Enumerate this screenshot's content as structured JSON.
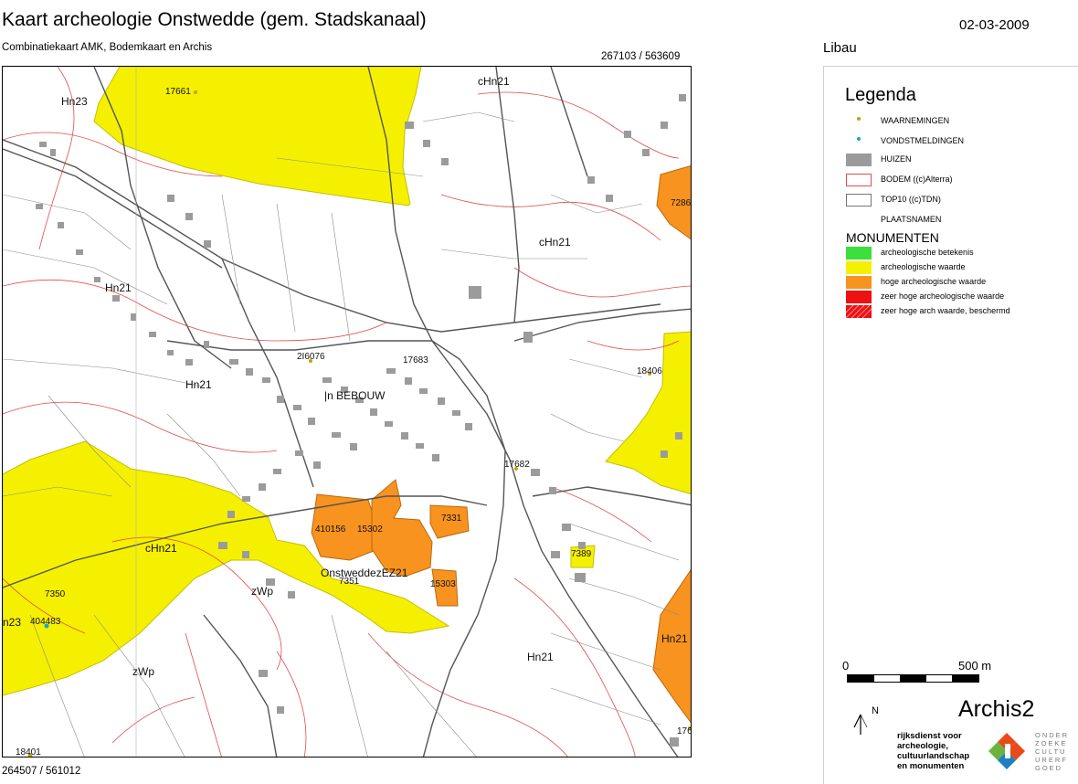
{
  "header": {
    "title": "Kaart archeologie Onstwedde (gem. Stadskanaal)",
    "date": "02-03-2009",
    "subtitle": "Combinatiekaart AMK, Bodemkaart en Archis",
    "coord_top_right": "267103 / 563609",
    "coord_bottom_left": "264507 / 561012",
    "place": "Libau"
  },
  "colors": {
    "yellow": "#f5f000",
    "orange": "#f7931e",
    "green": "#3ce03c",
    "red": "#ee1111",
    "house": "#9b9b9b",
    "soil_line": "#e24b4b",
    "road": "#555555"
  },
  "map_labels": {
    "hn23_top": "Hn23",
    "chn21_top": "cHn21",
    "chn21_right": "cHn21",
    "hn21_left": "Hn21",
    "hn21_mid": "Hn21",
    "bebouw": "|n BEBOUW",
    "chn21_left": "cHn21",
    "onstwedde": "OnstweddezEZ21",
    "zwp_1": "zWp",
    "zwp_2": "zWp",
    "n23": "n23",
    "hn21_bottom": "Hn21",
    "hn21_right": "Hn21"
  },
  "map_numbers": {
    "n17661": "17661",
    "n7286": "7286",
    "n25000": "2I6076",
    "n17683": "17683",
    "n18406": "18406",
    "n17682": "17682",
    "n410156": "410156",
    "n15302": "15302",
    "n7331": "7331",
    "n7389": "7389",
    "n7351": "7351",
    "n15303": "15303",
    "n7350": "7350",
    "n404483": "404483",
    "n18401": "18401",
    "n176": "176"
  },
  "legend": {
    "title": "Legenda",
    "items": [
      {
        "label": "WAARNEMINGEN",
        "symbol": "yellow-dot-icon"
      },
      {
        "label": "VONDSTMELDINGEN",
        "symbol": "cyan-dot-icon"
      },
      {
        "label": "HUIZEN",
        "symbol": "grey-box-icon"
      },
      {
        "label": "BODEM ((c)Alterra)",
        "symbol": "red-outline-box-icon"
      },
      {
        "label": "TOP10 ((c)TDN)",
        "symbol": "grey-outline-box-icon"
      },
      {
        "label": "PLAATSNAMEN",
        "symbol": "none"
      }
    ],
    "monumenten_title": "MONUMENTEN",
    "monumenten": [
      {
        "label": "archeologische betekenis",
        "color": "#3ce03c"
      },
      {
        "label": "archeologische waarde",
        "color": "#f5f000"
      },
      {
        "label": "hoge archeologische waarde",
        "color": "#f7931e"
      },
      {
        "label": "zeer hoge archeologische waarde",
        "color": "#ee1111"
      },
      {
        "label": "zeer hoge arch waarde, beschermd",
        "color": "#ee1111"
      }
    ]
  },
  "scale": {
    "start": "0",
    "end": "500 m"
  },
  "north": "N",
  "brand": {
    "archis": "Archis2",
    "rce": "rijksdienst voor\narcheologie,\ncultuurlandschap\nen monumenten",
    "oc": "ONDER\nZOEKE\nCULTU\nURERF\nGOED"
  }
}
